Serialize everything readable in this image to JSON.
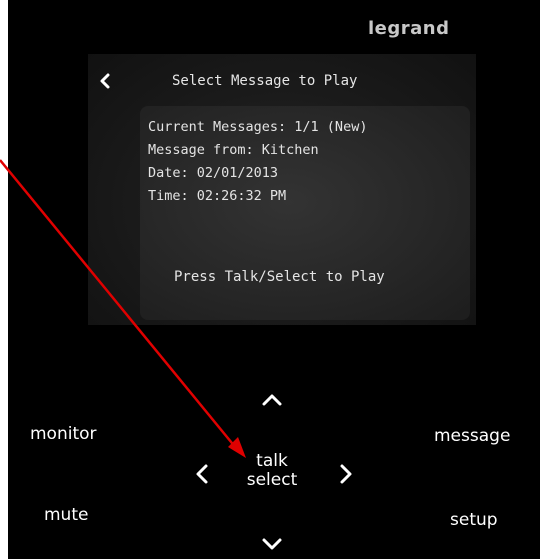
{
  "brand": "legrand",
  "screen": {
    "title": "Select Message to Play",
    "lines": [
      "Current Messages: 1/1 (New)",
      "Message from: Kitchen",
      "Date: 02/01/2013",
      "Time: 02:26:32 PM"
    ],
    "prompt": "Press Talk/Select to Play",
    "back_icon": "chevron-left-icon"
  },
  "controls": {
    "monitor": "monitor",
    "message": "message",
    "mute": "mute",
    "setup": "setup",
    "talk": "talk",
    "select": "select",
    "up_icon": "chevron-up-icon",
    "down_icon": "chevron-down-icon",
    "left_icon": "chevron-left-icon",
    "right_icon": "chevron-right-icon"
  },
  "colors": {
    "device": "#000000",
    "text": "#ffffff",
    "brand": "#c8c8c8",
    "annotation_arrow": "#e00000"
  }
}
